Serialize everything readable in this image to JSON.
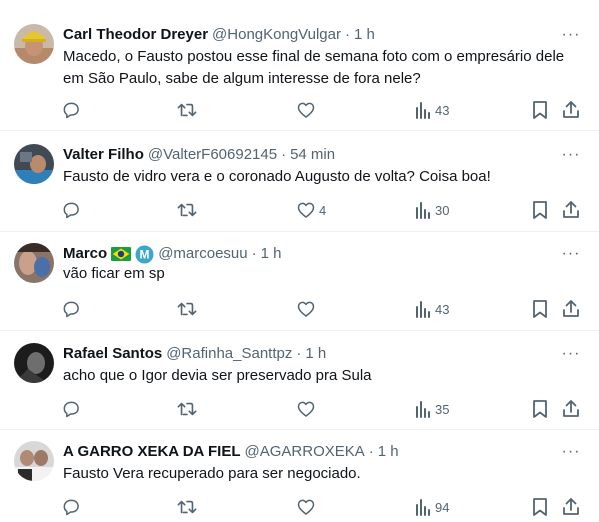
{
  "tweets": [
    {
      "name": "Carl Theodor Dreyer",
      "handle": "@HongKongVulgar",
      "time": "1 h",
      "text": "Macedo, o Fausto postou esse final de semana foto com o empresário dele em São Paulo, sabe de algum interesse de fora nele?",
      "replies": "",
      "retweets": "",
      "likes": "",
      "views": "43"
    },
    {
      "name": "Valter Filho",
      "handle": "@ValterF60692145",
      "time": "54 min",
      "text": "Fausto de vidro vera e o coronado Augusto de volta? Coisa boa!",
      "replies": "",
      "retweets": "",
      "likes": "4",
      "views": "30"
    },
    {
      "name": "Marco",
      "handle": "@marcoesuu",
      "time": "1 h",
      "text": "vão ficar em sp",
      "replies": "",
      "retweets": "",
      "likes": "",
      "views": "43",
      "badges": [
        "brazil-flag-icon",
        "m-logo-icon"
      ]
    },
    {
      "name": "Rafael Santos",
      "handle": "@Rafinha_Santtpz",
      "time": "1 h",
      "text": "acho que o Igor devia ser preservado pra Sula",
      "replies": "",
      "retweets": "",
      "likes": "",
      "views": "35"
    },
    {
      "name": "A GARRO XEKA DA FIEL",
      "handle": "@AGARROXEKA",
      "time": "1 h",
      "text": "Fausto Vera recuperado para ser negociado.",
      "replies": "",
      "retweets": "",
      "likes": "",
      "views": "94"
    }
  ],
  "icons": {
    "reply": "reply-icon",
    "retweet": "retweet-icon",
    "like": "like-icon",
    "views": "views-icon",
    "bookmark": "bookmark-icon",
    "share": "share-icon",
    "more": "more-icon"
  },
  "colors": {
    "text": "#0f1419",
    "secondary": "#536471",
    "divider": "#eff3f4",
    "brazil_green": "#1a9e3f",
    "brazil_yellow": "#fedd00",
    "m_logo": "#3ea7c9"
  },
  "more_glyph": "···",
  "dot": "·"
}
